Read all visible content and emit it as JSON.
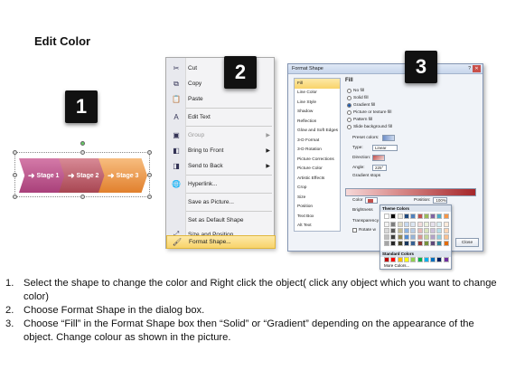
{
  "title": "Edit Color",
  "badges": [
    "1",
    "2",
    "3"
  ],
  "stages": [
    {
      "label": "Stage 1",
      "color": "#c35a8f"
    },
    {
      "label": "Stage 2",
      "color": "#c2636f"
    },
    {
      "label": "Stage 3",
      "color": "#ee9d52"
    }
  ],
  "context_menu": {
    "items": [
      {
        "label": "Cut",
        "icon": "scissors-icon"
      },
      {
        "label": "Copy",
        "icon": "copy-icon"
      },
      {
        "label": "Paste",
        "icon": "paste-icon"
      },
      {
        "label": "Edit Text",
        "icon": "edit-text-icon"
      },
      {
        "label": "Group",
        "icon": "group-icon",
        "disabled": true
      },
      {
        "label": "Bring to Front",
        "icon": "bring-front-icon",
        "submenu": true
      },
      {
        "label": "Send to Back",
        "icon": "send-back-icon",
        "submenu": true
      },
      {
        "label": "Hyperlink...",
        "icon": "hyperlink-icon"
      },
      {
        "label": "Save as Picture...",
        "icon": ""
      },
      {
        "label": "Set as Default Shape",
        "icon": ""
      },
      {
        "label": "Size and Position...",
        "icon": "size-icon"
      },
      {
        "label": "Format Shape...",
        "icon": "format-shape-icon",
        "highlighted": true
      }
    ]
  },
  "dialog": {
    "title": "Format Shape",
    "nav": [
      "Fill",
      "Line Color",
      "Line Style",
      "Shadow",
      "Reflection",
      "Glow and Soft Edges",
      "3-D Format",
      "3-D Rotation",
      "Picture Corrections",
      "Picture Color",
      "Artistic Effects",
      "Crop",
      "Size",
      "Position",
      "Text Box",
      "Alt Text"
    ],
    "section": "Fill",
    "fill_options": [
      "No fill",
      "Solid fill",
      "Gradient fill",
      "Picture or texture fill",
      "Pattern fill",
      "Slide background fill"
    ],
    "selected_fill": "Gradient fill",
    "preset_colors_label": "Preset colors:",
    "type_label": "Type:",
    "type_value": "Linear",
    "direction_label": "Direction:",
    "angle_label": "Angle:",
    "angle_value": "225°",
    "gradient_stops_label": "Gradient stops",
    "color_label": "Color",
    "position_label": "Position:",
    "position_value": "100%",
    "brightness_label": "Brightness",
    "transparency_label": "Transparency",
    "rotate_label": "Rotate w",
    "close_label": "Close"
  },
  "palette": {
    "theme_label": "Theme Colors",
    "standard_label": "Standard Colors",
    "more_label": "More Colors...",
    "theme_rows": [
      [
        "#ffffff",
        "#000000",
        "#eeece1",
        "#1f497d",
        "#4f81bd",
        "#c0504d",
        "#9bbb59",
        "#8064a2",
        "#4bacc6",
        "#f79646"
      ],
      [
        "#f2f2f2",
        "#7f7f7f",
        "#ddd9c3",
        "#c6d9f0",
        "#dbe5f1",
        "#f2dcdb",
        "#ebf1dd",
        "#e5e0ec",
        "#dbeef3",
        "#fdeada"
      ],
      [
        "#d8d8d8",
        "#595959",
        "#c4bd97",
        "#8db3e2",
        "#b8cce4",
        "#e5b9b7",
        "#d7e3bc",
        "#ccc1d9",
        "#b7dde8",
        "#fbd5b5"
      ],
      [
        "#bfbfbf",
        "#3f3f3f",
        "#938953",
        "#548dd4",
        "#95b3d7",
        "#d99694",
        "#c3d69b",
        "#b2a2c7",
        "#92cddc",
        "#fac08f"
      ],
      [
        "#a5a5a5",
        "#262626",
        "#494429",
        "#17365d",
        "#366092",
        "#953734",
        "#76923c",
        "#5f497a",
        "#31859b",
        "#e36c09"
      ]
    ],
    "standard": [
      "#c00000",
      "#ff0000",
      "#ffc000",
      "#ffff00",
      "#92d050",
      "#00b050",
      "#00b0f0",
      "#0070c0",
      "#002060",
      "#7030a0"
    ]
  },
  "instructions": [
    {
      "n": "1.",
      "text": "Select the shape to change the color and Right click the object( click any object which you want to change color)"
    },
    {
      "n": "2.",
      "text": "Choose Format Shape in the dialog box."
    },
    {
      "n": "3.",
      "text": "Choose “Fill” in the Format Shape box then “Solid” or “Gradient” depending on the appearance of the object. Change colour as shown in the picture."
    }
  ]
}
